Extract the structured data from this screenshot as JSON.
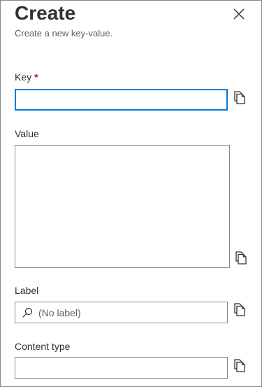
{
  "panel": {
    "title": "Create",
    "subtitle": "Create a new key-value."
  },
  "fields": {
    "key": {
      "label": "Key",
      "required_marker": "*",
      "value": ""
    },
    "value": {
      "label": "Value",
      "value": ""
    },
    "label": {
      "label": "Label",
      "placeholder": "(No label)",
      "value": ""
    },
    "content_type": {
      "label": "Content type",
      "value": ""
    }
  },
  "icons": {
    "close": "close-icon",
    "copy": "copy-icon",
    "search": "search-icon"
  },
  "colors": {
    "focus_border": "#0078d4",
    "required": "#a4262c",
    "border": "#8a8886"
  }
}
